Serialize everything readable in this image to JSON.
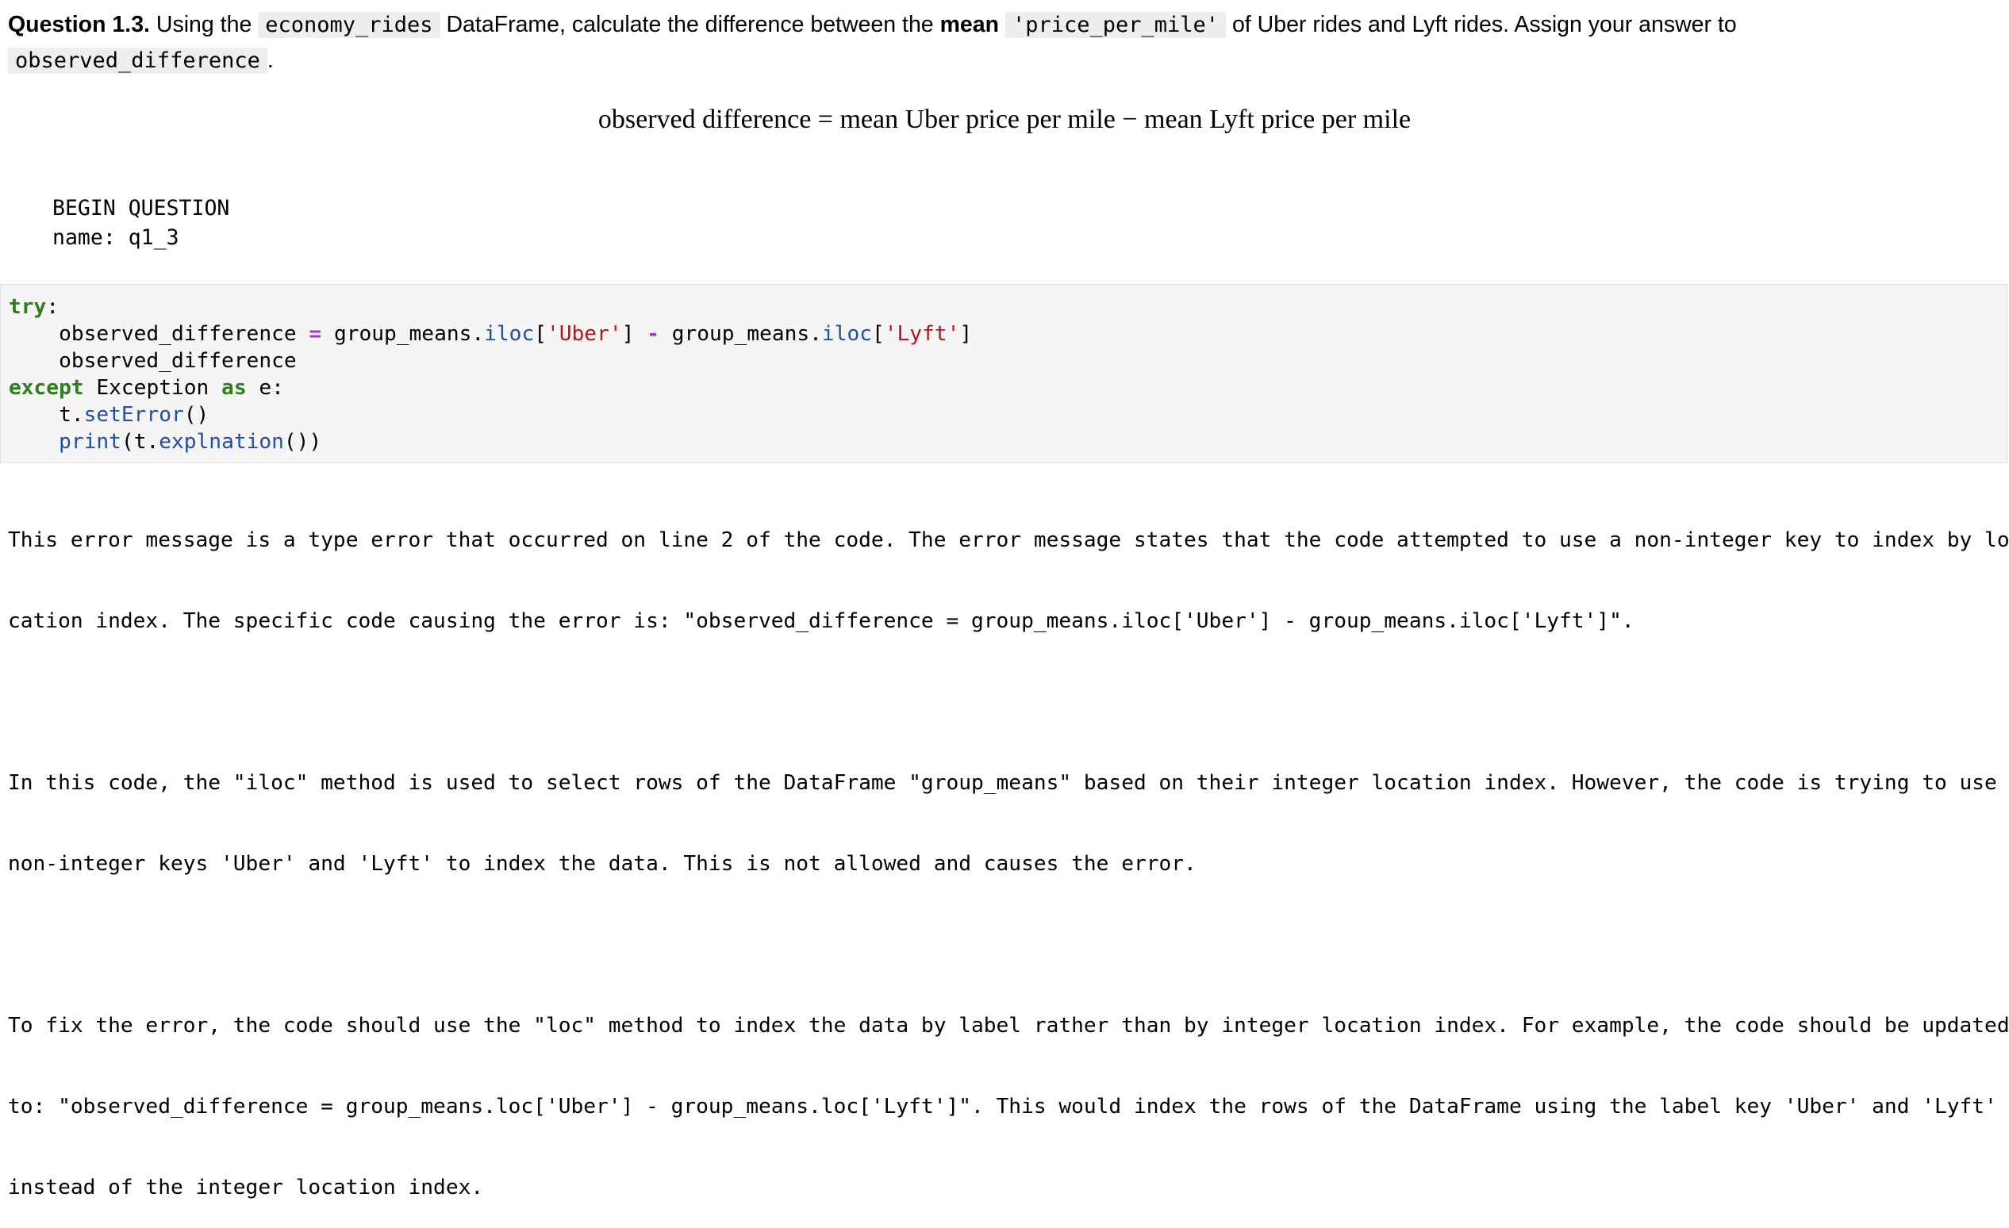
{
  "question": {
    "label": "Question 1.3.",
    "text_1": "Using the",
    "code_1": "economy_rides",
    "text_2": "DataFrame, calculate the difference between the",
    "bold_1": "mean",
    "code_2": "'price_per_mile'",
    "text_3": "of Uber rides and Lyft rides. Assign your answer to",
    "code_3": "observed_difference",
    "text_4": "."
  },
  "formula": "observed difference = mean Uber price per mile − mean Lyft price per mile",
  "begin_block": {
    "line_1": "BEGIN QUESTION",
    "line_2": "name: q1_3"
  },
  "code": {
    "try_kw": "try",
    "colon": ":",
    "line2_var": "    observed_difference ",
    "eq": "=",
    "line2_a": " group_means.",
    "iloc_1": "iloc",
    "br_open_1": "[",
    "str_uber": "'Uber'",
    "br_close_1": "] ",
    "minus": "-",
    "line2_b": " group_means.",
    "iloc_2": "iloc",
    "br_open_2": "[",
    "str_lyft": "'Lyft'",
    "br_close_2": "]",
    "line3": "    observed_difference",
    "except_kw": "except",
    "exception_name": " Exception ",
    "as_kw": "as",
    "e_colon": " e:",
    "line5_indent": "    t.",
    "set_error": "setError",
    "parens_1": "()",
    "line6_indent": "    ",
    "print_fn": "print",
    "line6_mid": "(t.",
    "explnation": "explnation",
    "parens_2": "())"
  },
  "output": {
    "lines": [
      "This error message is a type error that occurred on line 2 of the code. The error message states that the code attempted to use a non-integer key to index by lo",
      "cation index. The specific code causing the error is: \"observed_difference = group_means.iloc['Uber'] - group_means.iloc['Lyft']\".",
      "",
      "In this code, the \"iloc\" method is used to select rows of the DataFrame \"group_means\" based on their integer location index. However, the code is trying to use",
      "non-integer keys 'Uber' and 'Lyft' to index the data. This is not allowed and causes the error.",
      "",
      "To fix the error, the code should use the \"loc\" method to index the data by label rather than by integer location index. For example, the code should be updated",
      "to: \"observed_difference = group_means.loc['Uber'] - group_means.loc['Lyft']\". This would index the rows of the DataFrame using the label key 'Uber' and 'Lyft'",
      "instead of the integer location index."
    ]
  }
}
